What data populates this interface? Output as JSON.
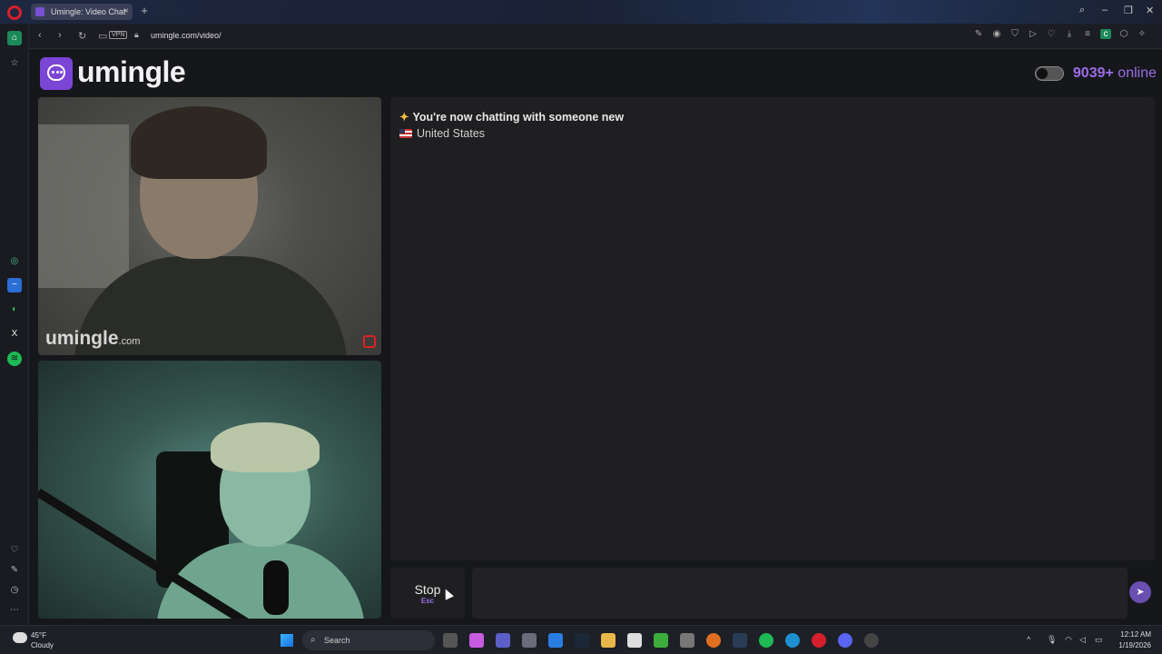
{
  "browser": {
    "tab_title": "Umingle: Video Chat",
    "url": "umingle.com/video/",
    "vpn_label": "VPN"
  },
  "site": {
    "logo_text": "umingle",
    "online_count": "9039+",
    "online_label": "online"
  },
  "video": {
    "watermark_main": "umingle",
    "watermark_suffix": ".com"
  },
  "chat": {
    "status_message": "You're now chatting with someone new",
    "country": "United States",
    "input_value": ""
  },
  "controls": {
    "stop_label": "Stop",
    "stop_shortcut": "Esc",
    "send_icon": "send-icon"
  },
  "taskbar": {
    "weather_temp": "45°F",
    "weather_condition": "Cloudy",
    "search_label": "Search",
    "time": "12:12 AM",
    "date": "1/19/2026"
  },
  "colors": {
    "brand": "#7b45d6",
    "online_accent": "#9b6ee8",
    "background": "#16171b"
  }
}
